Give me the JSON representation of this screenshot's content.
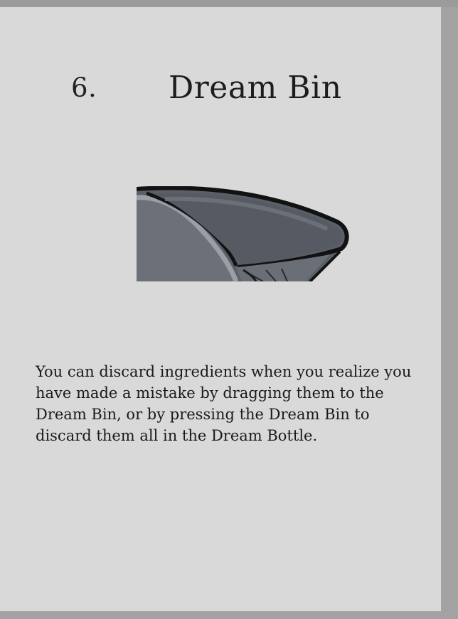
{
  "tutorial_page": {
    "step_number": "6.",
    "title": "Dream Bin",
    "illustration_icon": "dream-bin-bowl",
    "description": "You can discard ingredients when you realize you have made a mistake by dragging them to the Dream Bin, or by pressing the Dream Bin to discard them all in the Dream Bottle."
  },
  "colors": {
    "page_background": "#d9d9d9",
    "outer_frame": "#a3a3a3",
    "bin_body": "#5a5e66",
    "bin_rim": "#141414",
    "text": "#1a1a1a"
  }
}
